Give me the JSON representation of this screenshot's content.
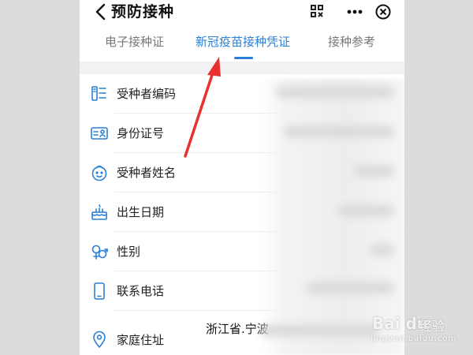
{
  "header": {
    "title": "预防接种",
    "icons": [
      "back-chevron-icon",
      "scan-icon",
      "more-icon",
      "close-circle-icon"
    ],
    "more_label": "•••"
  },
  "tabs": [
    {
      "label": "电子接种证",
      "active": false
    },
    {
      "label": "新冠疫苗接种凭证",
      "active": true
    },
    {
      "label": "接种参考",
      "active": false
    }
  ],
  "fields": [
    {
      "label": "受种者编码",
      "icon": "id-list-icon"
    },
    {
      "label": "身份证号",
      "icon": "id-card-icon"
    },
    {
      "label": "受种者姓名",
      "icon": "face-icon"
    },
    {
      "label": "出生日期",
      "icon": "birthday-cake-icon"
    },
    {
      "label": "性别",
      "icon": "gender-icon"
    },
    {
      "label": "联系电话",
      "icon": "phone-icon"
    },
    {
      "label": "家庭住址",
      "icon": "location-pin-icon",
      "value": "浙江省.宁波"
    }
  ],
  "watermark": {
    "brand": "Bai du",
    "cn": "经验",
    "url": "jingyan.baidu.com"
  },
  "colors": {
    "accent": "#2a7fd6",
    "arrow": "#e8312f",
    "icon": "#2a7fd6"
  }
}
